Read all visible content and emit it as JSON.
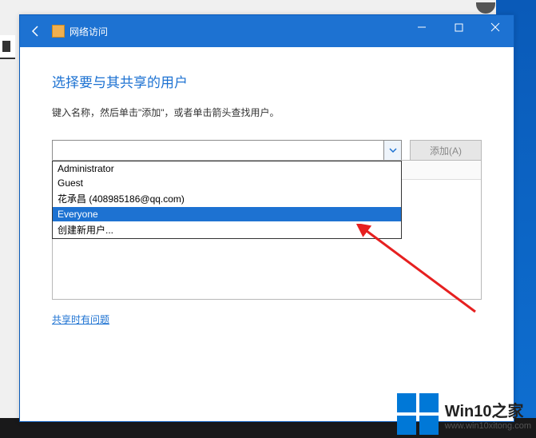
{
  "titlebar": {
    "title": "网络访问"
  },
  "dialog": {
    "heading": "选择要与其共享的用户",
    "instructions": "键入名称，然后单击\"添加\"，或者单击箭头查找用户。",
    "input_value": "",
    "add_label": "添加(A)",
    "help_link": "共享时有问题"
  },
  "dropdown": {
    "options": [
      "Administrator",
      "Guest",
      "花承昌 (408985186@qq.com)",
      "Everyone",
      "创建新用户..."
    ],
    "selected_index": 3
  },
  "watermark": {
    "brand": "Win10之家",
    "url": "www.win10xitong.com"
  }
}
